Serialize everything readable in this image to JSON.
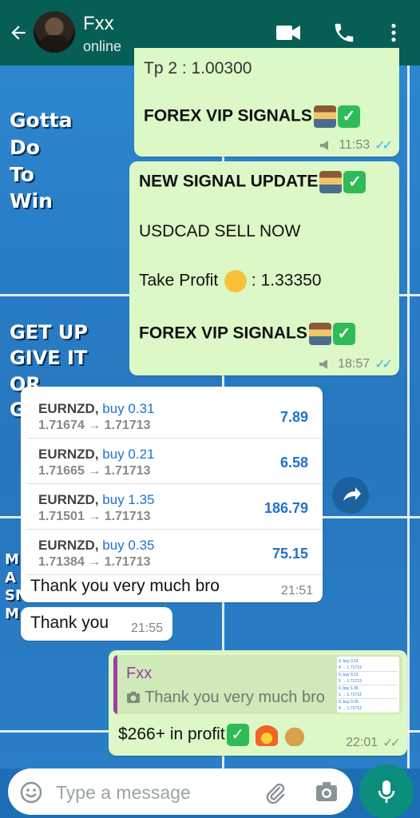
{
  "header": {
    "contact_name": "Fxx",
    "status": "online"
  },
  "wallpaper": {
    "lines_a": [
      "Gotta",
      "Do",
      "To",
      "Win"
    ],
    "lines_b": [
      "GET UP",
      "GIVE IT",
      "OR",
      "G"
    ],
    "lines_c": [
      "M",
      "A",
      "SM",
      "M"
    ]
  },
  "messages": {
    "m1": {
      "partial_line": "Tp 2 : 1.00300",
      "signature": "FOREX VIP SIGNALS",
      "time": "11:53"
    },
    "m2": {
      "title": "NEW SIGNAL UPDATE",
      "line1": "USDCAD SELL NOW",
      "line2_a": "Take Profit",
      "line2_b": ": 1.33350",
      "signature": "FOREX VIP SIGNALS",
      "time": "18:57"
    },
    "m3": {
      "trades": [
        {
          "pair": "EURNZD,",
          "side": "buy 0.31",
          "prices": "1.71674 → 1.71713",
          "profit": "7.89"
        },
        {
          "pair": "EURNZD,",
          "side": "buy 0.21",
          "prices": "1.71665 → 1.71713",
          "profit": "6.58"
        },
        {
          "pair": "EURNZD,",
          "side": "buy 1.35",
          "prices": "1.71501 → 1.71713",
          "profit": "186.79"
        },
        {
          "pair": "EURNZD,",
          "side": "buy 0.35",
          "prices": "1.71384 → 1.71713",
          "profit": "75.15"
        }
      ],
      "caption": "Thank you very much bro",
      "time": "21:51"
    },
    "m4": {
      "text": "Thank you",
      "time": "21:55"
    },
    "m5": {
      "quote_author": "Fxx",
      "quote_text": "Thank you very much bro",
      "text": "$266+ in profit",
      "time": "22:01"
    }
  },
  "composer": {
    "placeholder": "Type a message"
  },
  "colors": {
    "header": "#075e54",
    "outgoing_bubble": "#dcf8c6",
    "incoming_bubble": "#ffffff",
    "read_ticks": "#34b7f1",
    "quote_bar": "#9c3ea3",
    "mic_button": "#0b8e7b"
  },
  "icons": [
    "back-arrow-icon",
    "video-call-icon",
    "phone-icon",
    "more-vert-icon",
    "speaker-icon",
    "share-icon",
    "emoji-icon",
    "attach-icon",
    "camera-icon",
    "mic-icon"
  ]
}
